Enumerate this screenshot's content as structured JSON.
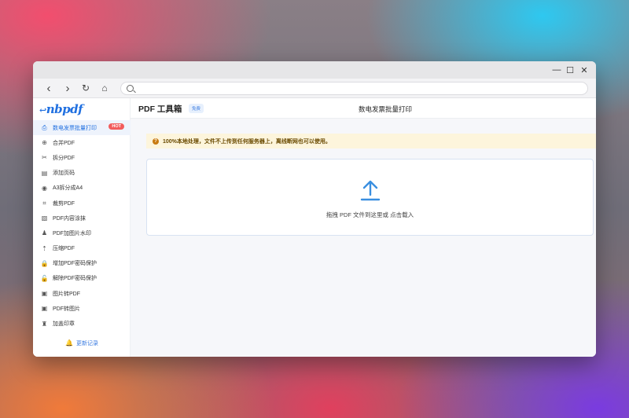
{
  "browser": {
    "window_controls": {
      "minimize": "—",
      "maximize": "☐",
      "close": "✕"
    },
    "nav": {
      "back": "‹",
      "forward": "›",
      "reload": "↻",
      "home": "⌂"
    },
    "address": {
      "value": ""
    }
  },
  "app": {
    "logo": "nbpdf",
    "title": "PDF 工具箱",
    "free_badge": "免费",
    "page_heading": "数电发票批量打印"
  },
  "sidebar": {
    "items": [
      {
        "label": "数电发票批量打印",
        "icon": "print-icon",
        "badge": "HOT",
        "active": true
      },
      {
        "label": "合并PDF",
        "icon": "merge-icon"
      },
      {
        "label": "拆分PDF",
        "icon": "scissors-icon"
      },
      {
        "label": "添加页码",
        "icon": "page-number-icon"
      },
      {
        "label": "A3拆分成A4",
        "icon": "eye-icon"
      },
      {
        "label": "裁剪PDF",
        "icon": "crop-icon"
      },
      {
        "label": "PDF内容涂抹",
        "icon": "smudge-icon"
      },
      {
        "label": "PDF加图片水印",
        "icon": "stamp-icon"
      },
      {
        "label": "压缩PDF",
        "icon": "compress-icon"
      },
      {
        "label": "增加PDF密码保护",
        "icon": "lock-icon"
      },
      {
        "label": "解除PDF密码保护",
        "icon": "unlock-icon"
      },
      {
        "label": "图片转PDF",
        "icon": "image-icon"
      },
      {
        "label": "PDF转图片",
        "icon": "image-icon"
      },
      {
        "label": "加盖印章",
        "icon": "seal-icon"
      }
    ],
    "feedback": "更新记录"
  },
  "notice": {
    "icon": "?",
    "text": "100%本地处理，文件不上传到任何服务器上，离线断网也可以使用。"
  },
  "dropzone": {
    "text": "拖拽 PDF 文件到这里或 点击载入"
  },
  "colors": {
    "accent": "#1f6fe0",
    "notice_bg": "#fdf5dc",
    "hot": "#f25c5c",
    "upload_icon": "#3a8fe0"
  }
}
